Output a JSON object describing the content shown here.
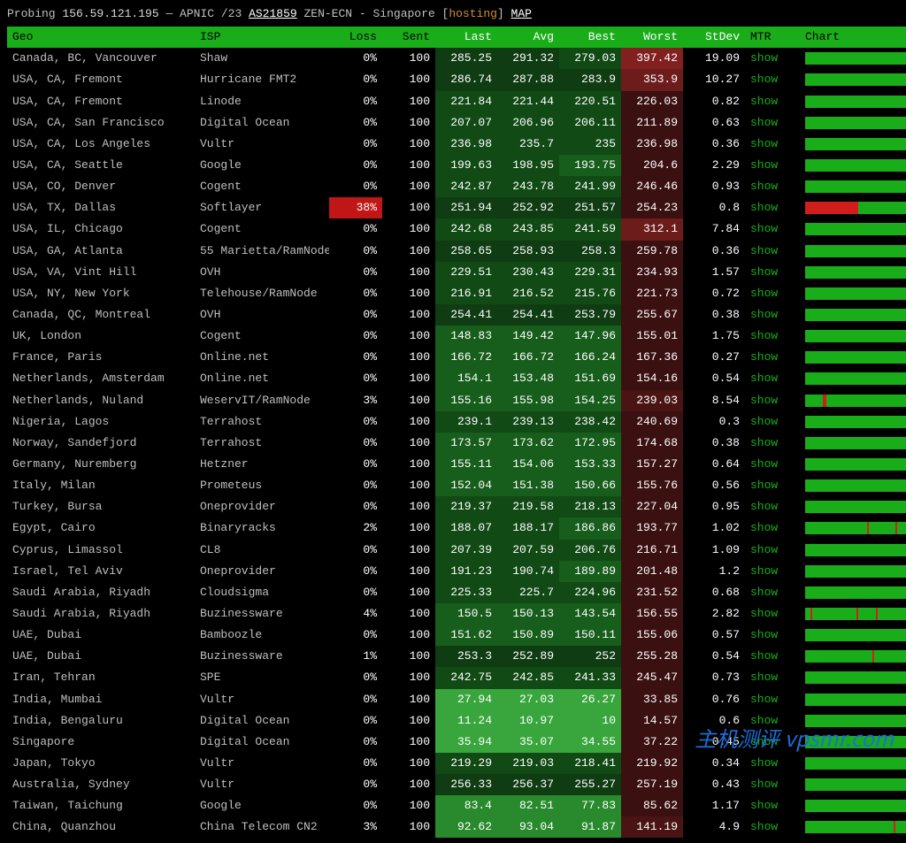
{
  "header": {
    "prefix": "Probing ",
    "ip": "156.59.121.195",
    "sep1": " — APNIC /23 ",
    "as": "AS21859",
    "sep2": " ZEN-ECN - Singapore [",
    "hosting": "hosting",
    "sep3": "] ",
    "map": "MAP"
  },
  "columns": [
    "Geo",
    "ISP",
    "Loss",
    "Sent",
    "Last",
    "Avg",
    "Best",
    "Worst",
    "StDev",
    "MTR",
    "Chart"
  ],
  "mtr_label": "show",
  "rows": [
    {
      "geo": "Canada, BC, Vancouver",
      "isp": "Shaw",
      "loss": "0%",
      "sent": "100",
      "last": "285.25",
      "avg": "291.32",
      "best": "279.03",
      "worst": "397.42",
      "stdev": "19.09",
      "lastC": "bg0",
      "avgC": "bg0",
      "bestC": "bg1",
      "worstC": "bg-wr4",
      "chart": [
        [
          "sg",
          72
        ],
        [
          "sd",
          1
        ],
        [
          "sg",
          15
        ],
        [
          "sd",
          1
        ],
        [
          "sy",
          1
        ],
        [
          "sd",
          1
        ],
        [
          "sg",
          9
        ]
      ]
    },
    {
      "geo": "USA, CA, Fremont",
      "isp": "Hurricane FMT2",
      "loss": "0%",
      "sent": "100",
      "last": "286.74",
      "avg": "287.88",
      "best": "283.9",
      "worst": "353.9",
      "stdev": "10.27",
      "lastC": "bg0",
      "avgC": "bg0",
      "bestC": "bg0",
      "worstC": "bg-wr3",
      "chart": [
        [
          "sg",
          90
        ],
        [
          "sy",
          1
        ],
        [
          "sg",
          9
        ]
      ]
    },
    {
      "geo": "USA, CA, Fremont",
      "isp": "Linode",
      "loss": "0%",
      "sent": "100",
      "last": "221.84",
      "avg": "221.44",
      "best": "220.51",
      "worst": "226.03",
      "stdev": "0.82",
      "lastC": "bg1",
      "avgC": "bg1",
      "bestC": "bg1",
      "worstC": "bg-wr0",
      "chart": [
        [
          "sg",
          100
        ]
      ]
    },
    {
      "geo": "USA, CA, San Francisco",
      "isp": "Digital Ocean",
      "loss": "0%",
      "sent": "100",
      "last": "207.07",
      "avg": "206.96",
      "best": "206.11",
      "worst": "211.89",
      "stdev": "0.63",
      "lastC": "bg1",
      "avgC": "bg1",
      "bestC": "bg1",
      "worstC": "bg-wr0",
      "chart": [
        [
          "sg",
          100
        ]
      ]
    },
    {
      "geo": "USA, CA, Los Angeles",
      "isp": "Vultr",
      "loss": "0%",
      "sent": "100",
      "last": "236.98",
      "avg": "235.7",
      "best": "235",
      "worst": "236.98",
      "stdev": "0.36",
      "lastC": "bg1",
      "avgC": "bg1",
      "bestC": "bg1",
      "worstC": "bg-wr0",
      "chart": [
        [
          "sg",
          100
        ]
      ]
    },
    {
      "geo": "USA, CA, Seattle",
      "isp": "Google",
      "loss": "0%",
      "sent": "100",
      "last": "199.63",
      "avg": "198.95",
      "best": "193.75",
      "worst": "204.6",
      "stdev": "2.29",
      "lastC": "bg1",
      "avgC": "bg1",
      "bestC": "bg2",
      "worstC": "bg-wr0",
      "chart": [
        [
          "sg",
          100
        ]
      ]
    },
    {
      "geo": "USA, CO, Denver",
      "isp": "Cogent",
      "loss": "0%",
      "sent": "100",
      "last": "242.87",
      "avg": "243.78",
      "best": "241.99",
      "worst": "246.46",
      "stdev": "0.93",
      "lastC": "bg1",
      "avgC": "bg1",
      "bestC": "bg1",
      "worstC": "bg-wr0",
      "chart": [
        [
          "sg",
          100
        ]
      ]
    },
    {
      "geo": "USA, TX, Dallas",
      "isp": "Softlayer",
      "loss": "38%",
      "lossBad": true,
      "sent": "100",
      "last": "251.94",
      "avg": "252.92",
      "best": "251.57",
      "worst": "254.23",
      "stdev": "0.8",
      "lastC": "bg0",
      "avgC": "bg0",
      "bestC": "bg0",
      "worstC": "bg-wr0",
      "chart": [
        [
          "sr",
          30
        ],
        [
          "sg",
          60
        ],
        [
          "sd",
          5
        ],
        [
          "sr",
          5
        ]
      ]
    },
    {
      "geo": "USA, IL, Chicago",
      "isp": "Cogent",
      "loss": "0%",
      "sent": "100",
      "last": "242.68",
      "avg": "243.85",
      "best": "241.59",
      "worst": "312.1",
      "stdev": "7.84",
      "lastC": "bg1",
      "avgC": "bg1",
      "bestC": "bg1",
      "worstC": "bg-wr3",
      "chart": [
        [
          "sg",
          100
        ]
      ]
    },
    {
      "geo": "USA, GA, Atlanta",
      "isp": "55 Marietta/RamNode",
      "loss": "0%",
      "sent": "100",
      "last": "258.65",
      "avg": "258.93",
      "best": "258.3",
      "worst": "259.78",
      "stdev": "0.36",
      "lastC": "bg0",
      "avgC": "bg0",
      "bestC": "bg0",
      "worstC": "bg-wr0",
      "chart": [
        [
          "sg",
          100
        ]
      ]
    },
    {
      "geo": "USA, VA, Vint Hill",
      "isp": "OVH",
      "loss": "0%",
      "sent": "100",
      "last": "229.51",
      "avg": "230.43",
      "best": "229.31",
      "worst": "234.93",
      "stdev": "1.57",
      "lastC": "bg1",
      "avgC": "bg1",
      "bestC": "bg1",
      "worstC": "bg-wr0",
      "chart": [
        [
          "sg",
          100
        ]
      ]
    },
    {
      "geo": "USA, NY, New York",
      "isp": "Telehouse/RamNode",
      "loss": "0%",
      "sent": "100",
      "last": "216.91",
      "avg": "216.52",
      "best": "215.76",
      "worst": "221.73",
      "stdev": "0.72",
      "lastC": "bg1",
      "avgC": "bg1",
      "bestC": "bg1",
      "worstC": "bg-wr0",
      "chart": [
        [
          "sg",
          100
        ]
      ]
    },
    {
      "geo": "Canada, QC, Montreal",
      "isp": "OVH",
      "loss": "0%",
      "sent": "100",
      "last": "254.41",
      "avg": "254.41",
      "best": "253.79",
      "worst": "255.67",
      "stdev": "0.38",
      "lastC": "bg0",
      "avgC": "bg0",
      "bestC": "bg0",
      "worstC": "bg-wr0",
      "chart": [
        [
          "sg",
          100
        ]
      ]
    },
    {
      "geo": "UK, London",
      "isp": "Cogent",
      "loss": "0%",
      "sent": "100",
      "last": "148.83",
      "avg": "149.42",
      "best": "147.96",
      "worst": "155.01",
      "stdev": "1.75",
      "lastC": "bg2",
      "avgC": "bg2",
      "bestC": "bg2",
      "worstC": "bg-wr0",
      "chart": [
        [
          "sg",
          100
        ]
      ]
    },
    {
      "geo": "France, Paris",
      "isp": "Online.net",
      "loss": "0%",
      "sent": "100",
      "last": "166.72",
      "avg": "166.72",
      "best": "166.24",
      "worst": "167.36",
      "stdev": "0.27",
      "lastC": "bg2",
      "avgC": "bg2",
      "bestC": "bg2",
      "worstC": "bg-wr0",
      "chart": [
        [
          "sg",
          100
        ]
      ]
    },
    {
      "geo": "Netherlands, Amsterdam",
      "isp": "Online.net",
      "loss": "0%",
      "sent": "100",
      "last": "154.1",
      "avg": "153.48",
      "best": "151.69",
      "worst": "154.16",
      "stdev": "0.54",
      "lastC": "bg2",
      "avgC": "bg2",
      "bestC": "bg2",
      "worstC": "bg-wr0",
      "chart": [
        [
          "sg",
          100
        ]
      ]
    },
    {
      "geo": "Netherlands, Nuland",
      "isp": "WeservIT/RamNode",
      "loss": "3%",
      "sent": "100",
      "last": "155.16",
      "avg": "155.98",
      "best": "154.25",
      "worst": "239.03",
      "stdev": "8.54",
      "lastC": "bg2",
      "avgC": "bg2",
      "bestC": "bg2",
      "worstC": "bg-wr1",
      "chart": [
        [
          "sg",
          10
        ],
        [
          "sr",
          2
        ],
        [
          "sg",
          88
        ]
      ]
    },
    {
      "geo": "Nigeria, Lagos",
      "isp": "Terrahost",
      "loss": "0%",
      "sent": "100",
      "last": "239.1",
      "avg": "239.13",
      "best": "238.42",
      "worst": "240.69",
      "stdev": "0.3",
      "lastC": "bg1",
      "avgC": "bg1",
      "bestC": "bg1",
      "worstC": "bg-wr0",
      "chart": [
        [
          "sg",
          100
        ]
      ]
    },
    {
      "geo": "Norway, Sandefjord",
      "isp": "Terrahost",
      "loss": "0%",
      "sent": "100",
      "last": "173.57",
      "avg": "173.62",
      "best": "172.95",
      "worst": "174.68",
      "stdev": "0.38",
      "lastC": "bg2",
      "avgC": "bg2",
      "bestC": "bg2",
      "worstC": "bg-wr0",
      "chart": [
        [
          "sg",
          100
        ]
      ]
    },
    {
      "geo": "Germany, Nuremberg",
      "isp": "Hetzner",
      "loss": "0%",
      "sent": "100",
      "last": "155.11",
      "avg": "154.06",
      "best": "153.33",
      "worst": "157.27",
      "stdev": "0.64",
      "lastC": "bg2",
      "avgC": "bg2",
      "bestC": "bg2",
      "worstC": "bg-wr0",
      "chart": [
        [
          "sg",
          100
        ]
      ]
    },
    {
      "geo": "Italy, Milan",
      "isp": "Prometeus",
      "loss": "0%",
      "sent": "100",
      "last": "152.04",
      "avg": "151.38",
      "best": "150.66",
      "worst": "155.76",
      "stdev": "0.56",
      "lastC": "bg2",
      "avgC": "bg2",
      "bestC": "bg2",
      "worstC": "bg-wr0",
      "chart": [
        [
          "sg",
          100
        ]
      ]
    },
    {
      "geo": "Turkey, Bursa",
      "isp": "Oneprovider",
      "loss": "0%",
      "sent": "100",
      "last": "219.37",
      "avg": "219.58",
      "best": "218.13",
      "worst": "227.04",
      "stdev": "0.95",
      "lastC": "bg1",
      "avgC": "bg1",
      "bestC": "bg1",
      "worstC": "bg-wr0",
      "chart": [
        [
          "sg",
          100
        ]
      ]
    },
    {
      "geo": "Egypt, Cairo",
      "isp": "Binaryracks",
      "loss": "2%",
      "sent": "100",
      "last": "188.07",
      "avg": "188.17",
      "best": "186.86",
      "worst": "193.77",
      "stdev": "1.02",
      "lastC": "bg1",
      "avgC": "bg1",
      "bestC": "bg2",
      "worstC": "bg-wr0",
      "chart": [
        [
          "sg",
          35
        ],
        [
          "sr",
          1
        ],
        [
          "sg",
          15
        ],
        [
          "sr",
          1
        ],
        [
          "sg",
          48
        ]
      ]
    },
    {
      "geo": "Cyprus, Limassol",
      "isp": "CL8",
      "loss": "0%",
      "sent": "100",
      "last": "207.39",
      "avg": "207.59",
      "best": "206.76",
      "worst": "216.71",
      "stdev": "1.09",
      "lastC": "bg1",
      "avgC": "bg1",
      "bestC": "bg1",
      "worstC": "bg-wr0",
      "chart": [
        [
          "sg",
          100
        ]
      ]
    },
    {
      "geo": "Israel, Tel Aviv",
      "isp": "Oneprovider",
      "loss": "0%",
      "sent": "100",
      "last": "191.23",
      "avg": "190.74",
      "best": "189.89",
      "worst": "201.48",
      "stdev": "1.2",
      "lastC": "bg1",
      "avgC": "bg1",
      "bestC": "bg2",
      "worstC": "bg-wr0",
      "chart": [
        [
          "sg",
          100
        ]
      ]
    },
    {
      "geo": "Saudi Arabia, Riyadh",
      "isp": "Cloudsigma",
      "loss": "0%",
      "sent": "100",
      "last": "225.33",
      "avg": "225.7",
      "best": "224.96",
      "worst": "231.52",
      "stdev": "0.68",
      "lastC": "bg1",
      "avgC": "bg1",
      "bestC": "bg1",
      "worstC": "bg-wr0",
      "chart": [
        [
          "sg",
          100
        ]
      ]
    },
    {
      "geo": "Saudi Arabia, Riyadh",
      "isp": "Buzinessware",
      "loss": "4%",
      "sent": "100",
      "last": "150.5",
      "avg": "150.13",
      "best": "143.54",
      "worst": "156.55",
      "stdev": "2.82",
      "lastC": "bg2",
      "avgC": "bg2",
      "bestC": "bg2",
      "worstC": "bg-wr0",
      "chart": [
        [
          "sg",
          3
        ],
        [
          "sr",
          1
        ],
        [
          "sg",
          25
        ],
        [
          "sr",
          1
        ],
        [
          "sg",
          10
        ],
        [
          "sr",
          1
        ],
        [
          "sg",
          45
        ],
        [
          "sr",
          1
        ],
        [
          "sg",
          13
        ]
      ]
    },
    {
      "geo": "UAE, Dubai",
      "isp": "Bamboozle",
      "loss": "0%",
      "sent": "100",
      "last": "151.62",
      "avg": "150.89",
      "best": "150.11",
      "worst": "155.06",
      "stdev": "0.57",
      "lastC": "bg2",
      "avgC": "bg2",
      "bestC": "bg2",
      "worstC": "bg-wr0",
      "chart": [
        [
          "sg",
          100
        ]
      ]
    },
    {
      "geo": "UAE, Dubai",
      "isp": "Buzinessware",
      "loss": "1%",
      "sent": "100",
      "last": "253.3",
      "avg": "252.89",
      "best": "252",
      "worst": "255.28",
      "stdev": "0.54",
      "lastC": "bg0",
      "avgC": "bg0",
      "bestC": "bg0",
      "worstC": "bg-wr0",
      "chart": [
        [
          "sg",
          38
        ],
        [
          "sr",
          1
        ],
        [
          "sg",
          61
        ]
      ]
    },
    {
      "geo": "Iran, Tehran",
      "isp": "SPE",
      "loss": "0%",
      "sent": "100",
      "last": "242.75",
      "avg": "242.85",
      "best": "241.33",
      "worst": "245.47",
      "stdev": "0.73",
      "lastC": "bg1",
      "avgC": "bg1",
      "bestC": "bg1",
      "worstC": "bg-wr0",
      "chart": [
        [
          "sg",
          100
        ]
      ]
    },
    {
      "geo": "India, Mumbai",
      "isp": "Vultr",
      "loss": "0%",
      "sent": "100",
      "last": "27.94",
      "avg": "27.03",
      "best": "26.27",
      "worst": "33.85",
      "stdev": "0.76",
      "lastC": "bg5",
      "avgC": "bg5",
      "bestC": "bg5",
      "worstC": "bg-wr0",
      "chart": [
        [
          "sg",
          100
        ]
      ]
    },
    {
      "geo": "India, Bengaluru",
      "isp": "Digital Ocean",
      "loss": "0%",
      "sent": "100",
      "last": "11.24",
      "avg": "10.97",
      "best": "10",
      "worst": "14.57",
      "stdev": "0.6",
      "lastC": "bg5",
      "avgC": "bg5",
      "bestC": "bg5",
      "worstC": "bg-wr0",
      "chart": [
        [
          "sg",
          100
        ]
      ]
    },
    {
      "geo": "Singapore",
      "isp": "Digital Ocean",
      "loss": "0%",
      "sent": "100",
      "last": "35.94",
      "avg": "35.07",
      "best": "34.55",
      "worst": "37.22",
      "stdev": "0.45",
      "lastC": "bg5",
      "avgC": "bg5",
      "bestC": "bg5",
      "worstC": "bg-wr0",
      "chart": [
        [
          "sg",
          100
        ]
      ]
    },
    {
      "geo": "Japan, Tokyo",
      "isp": "Vultr",
      "loss": "0%",
      "sent": "100",
      "last": "219.29",
      "avg": "219.03",
      "best": "218.41",
      "worst": "219.92",
      "stdev": "0.34",
      "lastC": "bg1",
      "avgC": "bg1",
      "bestC": "bg1",
      "worstC": "bg-wr0",
      "chart": [
        [
          "sg",
          100
        ]
      ]
    },
    {
      "geo": "Australia, Sydney",
      "isp": "Vultr",
      "loss": "0%",
      "sent": "100",
      "last": "256.33",
      "avg": "256.37",
      "best": "255.27",
      "worst": "257.19",
      "stdev": "0.43",
      "lastC": "bg0",
      "avgC": "bg0",
      "bestC": "bg0",
      "worstC": "bg-wr0",
      "chart": [
        [
          "sg",
          100
        ]
      ]
    },
    {
      "geo": "Taiwan, Taichung",
      "isp": "Google",
      "loss": "0%",
      "sent": "100",
      "last": "83.4",
      "avg": "82.51",
      "best": "77.83",
      "worst": "85.62",
      "stdev": "1.17",
      "lastC": "bg4",
      "avgC": "bg4",
      "bestC": "bg4",
      "worstC": "bg-wr0",
      "chart": [
        [
          "sg",
          100
        ]
      ]
    },
    {
      "geo": "China, Quanzhou",
      "isp": "China Telecom CN2",
      "loss": "3%",
      "sent": "100",
      "last": "92.62",
      "avg": "93.04",
      "best": "91.87",
      "worst": "141.19",
      "stdev": "4.9",
      "lastC": "bg4",
      "avgC": "bg4",
      "bestC": "bg4",
      "worstC": "bg-wr1",
      "chart": [
        [
          "sg",
          50
        ],
        [
          "sr",
          1
        ],
        [
          "sg",
          20
        ],
        [
          "sr",
          1
        ],
        [
          "sg",
          10
        ],
        [
          "sr",
          1
        ],
        [
          "sg",
          17
        ]
      ]
    }
  ],
  "watermark": "主机测评 vpsmr.com"
}
